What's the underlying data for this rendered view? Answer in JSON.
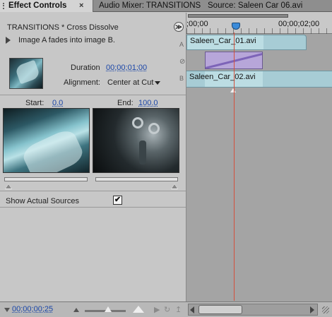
{
  "tabs": {
    "active": "Effect Controls",
    "close_glyph": "×",
    "audio_mixer": "Audio Mixer: TRANSITIONS",
    "source": "Source: Saleen  Car  06.avi"
  },
  "effect": {
    "header": "TRANSITIONS * Cross Dissolve",
    "menu_glyph": "≫",
    "description": "Image A fades into image B.",
    "duration_label": "Duration",
    "duration_value": "00;00;01;00",
    "alignment_label": "Alignment:",
    "alignment_value": "Center at Cut",
    "start_label": "Start:",
    "start_value": "0.0",
    "end_label": "End:",
    "end_value": "100.0",
    "show_sources_label": "Show Actual Sources",
    "show_sources_checked": true,
    "check_glyph": "✔"
  },
  "side_marks": {
    "a": "A",
    "b": "B"
  },
  "timeline": {
    "tc_start": ";00;00",
    "tc_end": "00;00;02;00",
    "clip_a": "Saleen_Car_01.avi",
    "clip_b": "Saleen_Car_02.avi"
  },
  "bottom": {
    "timecode": "00;00;00;25"
  },
  "icons": {
    "close": "close-icon",
    "menu": "panel-menu-icon",
    "play": "play-transition-icon",
    "dropdown": "dropdown-arrow-icon",
    "checkbox": "checkbox-icon"
  },
  "colors": {
    "timecode_link": "#1a46a8",
    "clip": "#a7ccd5",
    "transition": "#b7a6d9",
    "playhead_line": "#d4503c"
  }
}
